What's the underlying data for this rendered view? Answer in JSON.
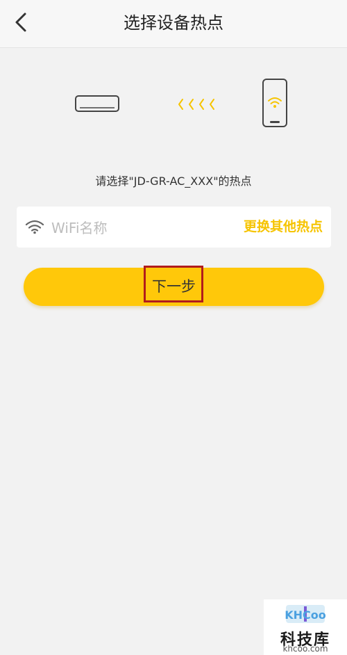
{
  "header": {
    "title": "选择设备热点",
    "back_icon": "chevron-left-icon"
  },
  "illustration": {
    "device_icon": "air-conditioner-icon",
    "transfer_icon": "chevrons-left-icon",
    "phone_icon": "phone-wifi-icon",
    "accent_color": "#f6c400"
  },
  "instruction": "请选择\"JD-GR-AC_XXX\"的热点",
  "wifi": {
    "icon": "wifi-icon",
    "value": "",
    "placeholder": "WiFi名称",
    "change_label": "更换其他热点"
  },
  "next_button": {
    "label": "下一步",
    "color": "#ffc80a"
  },
  "watermark": {
    "logo_text": "KHCoo",
    "name": "科技库",
    "url": "khcoo.com"
  }
}
